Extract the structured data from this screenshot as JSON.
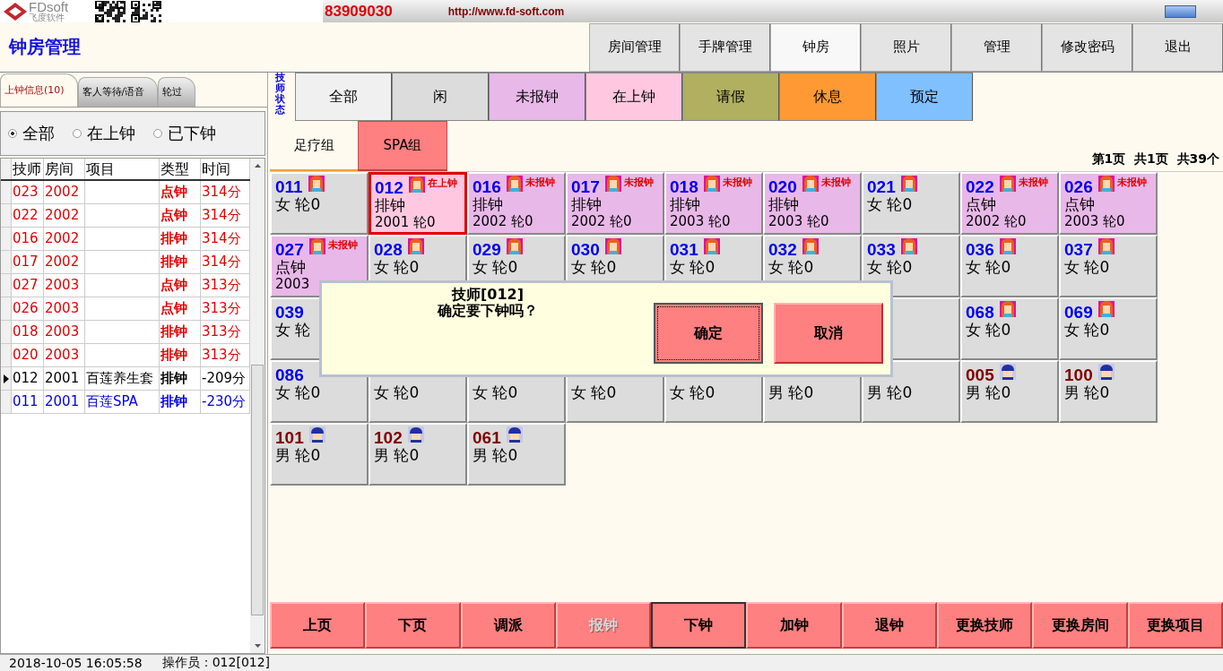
{
  "header": {
    "logo_text": "FDsoft",
    "logo_subtext": "飞度软件",
    "phone": "83909030",
    "url": "http://www.fd-soft.com"
  },
  "title": "钟房管理",
  "nav": [
    {
      "label": "房间管理",
      "selected": false
    },
    {
      "label": "手牌管理",
      "selected": false
    },
    {
      "label": "钟房",
      "selected": true
    },
    {
      "label": "照片",
      "selected": false
    },
    {
      "label": "管理",
      "selected": false
    },
    {
      "label": "修改密码",
      "selected": false
    },
    {
      "label": "退出",
      "selected": false
    }
  ],
  "left_tabs": [
    {
      "label": "上钟信息(10)",
      "selected": true
    },
    {
      "label": "客人等待/语音",
      "selected": false
    },
    {
      "label": "轮过",
      "selected": false
    }
  ],
  "radios": [
    {
      "label": "全部",
      "selected": true
    },
    {
      "label": "在上钟",
      "selected": false
    },
    {
      "label": "已下钟",
      "selected": false
    }
  ],
  "table": {
    "columns": [
      "技师",
      "房间",
      "项目",
      "类型",
      "时间"
    ],
    "rows": [
      {
        "cells": [
          "023",
          "2002",
          "",
          "点钟",
          "314分"
        ],
        "color": "#e00000",
        "selected": false
      },
      {
        "cells": [
          "022",
          "2002",
          "",
          "点钟",
          "314分"
        ],
        "color": "#e00000",
        "selected": false
      },
      {
        "cells": [
          "016",
          "2002",
          "",
          "排钟",
          "314分"
        ],
        "color": "#e00000",
        "selected": false
      },
      {
        "cells": [
          "017",
          "2002",
          "",
          "排钟",
          "314分"
        ],
        "color": "#e00000",
        "selected": false
      },
      {
        "cells": [
          "027",
          "2003",
          "",
          "点钟",
          "313分"
        ],
        "color": "#e00000",
        "selected": false
      },
      {
        "cells": [
          "026",
          "2003",
          "",
          "点钟",
          "313分"
        ],
        "color": "#e00000",
        "selected": false
      },
      {
        "cells": [
          "018",
          "2003",
          "",
          "排钟",
          "313分"
        ],
        "color": "#e00000",
        "selected": false
      },
      {
        "cells": [
          "020",
          "2003",
          "",
          "排钟",
          "313分"
        ],
        "color": "#e00000",
        "selected": false
      },
      {
        "cells": [
          "012",
          "2001",
          "百莲养生套",
          "排钟",
          "-209分"
        ],
        "color": "#000000",
        "selected": true
      },
      {
        "cells": [
          "011",
          "2001",
          "百莲SPA",
          "排钟",
          "-230分"
        ],
        "color": "#0000e0",
        "selected": false
      }
    ]
  },
  "status_label": "技师状态",
  "filters": [
    {
      "label": "全部",
      "color": "#f0f0f0"
    },
    {
      "label": "闲",
      "color": "#dcdcdc"
    },
    {
      "label": "未报钟",
      "color": "#e8b8e8"
    },
    {
      "label": "在上钟",
      "color": "#ffc8e0"
    },
    {
      "label": "请假",
      "color": "#b0b060"
    },
    {
      "label": "休息",
      "color": "#ff9933"
    },
    {
      "label": "预定",
      "color": "#80c0ff"
    }
  ],
  "groups": [
    {
      "label": "足疗组",
      "selected": true
    },
    {
      "label": "SPA组",
      "selected": false
    }
  ],
  "page_info": "第1页  共1页  共39个",
  "cards": [
    {
      "number": "011",
      "color": "#0000f0",
      "male": false,
      "kind": "idle",
      "selected": false,
      "line2": "女 轮0"
    },
    {
      "number": "012",
      "color": "#0000f0",
      "male": false,
      "kind": "onduty",
      "selected": true,
      "status": "在上钟",
      "line2": "排钟",
      "line3": "2001 轮0"
    },
    {
      "number": "016",
      "color": "#0000f0",
      "male": false,
      "kind": "unreported",
      "selected": false,
      "status": "未报钟",
      "line2": "排钟",
      "line3": "2002 轮0"
    },
    {
      "number": "017",
      "color": "#0000f0",
      "male": false,
      "kind": "unreported",
      "selected": false,
      "status": "未报钟",
      "line2": "排钟",
      "line3": "2002 轮0"
    },
    {
      "number": "018",
      "color": "#0000f0",
      "male": false,
      "kind": "unreported",
      "selected": false,
      "status": "未报钟",
      "line2": "排钟",
      "line3": "2003 轮0"
    },
    {
      "number": "020",
      "color": "#0000f0",
      "male": false,
      "kind": "unreported",
      "selected": false,
      "status": "未报钟",
      "line2": "排钟",
      "line3": "2003 轮0"
    },
    {
      "number": "021",
      "color": "#0000f0",
      "male": false,
      "kind": "idle",
      "selected": false,
      "line2": "女 轮0"
    },
    {
      "number": "022",
      "color": "#0000f0",
      "male": false,
      "kind": "unreported",
      "selected": false,
      "status": "未报钟",
      "line2": "点钟",
      "line3": "2002 轮0"
    },
    {
      "number": "026",
      "color": "#0000f0",
      "male": false,
      "kind": "unreported",
      "selected": false,
      "status": "未报钟",
      "line2": "点钟",
      "line3": "2003 轮0"
    },
    {
      "number": "027",
      "color": "#0000f0",
      "male": false,
      "kind": "unreported",
      "selected": false,
      "status": "未报钟",
      "line2": "点钟",
      "line3": "2003"
    },
    {
      "number": "028",
      "color": "#0000f0",
      "male": false,
      "kind": "idle",
      "selected": false,
      "line2": "女 轮0"
    },
    {
      "number": "029",
      "color": "#0000f0",
      "male": false,
      "kind": "idle",
      "selected": false,
      "line2": "女 轮0"
    },
    {
      "number": "030",
      "color": "#0000f0",
      "male": false,
      "kind": "idle",
      "selected": false,
      "line2": "女 轮0"
    },
    {
      "number": "031",
      "color": "#0000f0",
      "male": false,
      "kind": "idle",
      "selected": false,
      "line2": "女 轮0"
    },
    {
      "number": "032",
      "color": "#0000f0",
      "male": false,
      "kind": "idle",
      "selected": false,
      "line2": "女 轮0"
    },
    {
      "number": "033",
      "color": "#0000f0",
      "male": false,
      "kind": "idle",
      "selected": false,
      "line2": "女 轮0"
    },
    {
      "number": "036",
      "color": "#0000f0",
      "male": false,
      "kind": "idle",
      "selected": false,
      "line2": "女 轮0"
    },
    {
      "number": "037",
      "color": "#0000f0",
      "male": false,
      "kind": "idle",
      "selected": false,
      "line2": "女 轮0"
    },
    {
      "number": "039",
      "color": "#0000f0",
      "kind": "idle",
      "selected": false,
      "line2": "女 轮"
    },
    {
      "kind": "idle"
    },
    {
      "number": "068",
      "color": "#0000f0",
      "male": false,
      "kind": "idle",
      "selected": false,
      "line2": "女 轮0"
    },
    {
      "number": "069",
      "color": "#0000f0",
      "male": false,
      "kind": "idle",
      "selected": false,
      "line2": "女 轮0"
    },
    {
      "number": "086",
      "color": "#0000f0",
      "kind": "idle",
      "selected": false,
      "line2": "女 轮0"
    },
    {
      "kind": "idle",
      "line2": "女 轮0"
    },
    {
      "kind": "idle",
      "line2": "女 轮0"
    },
    {
      "kind": "idle",
      "line2": "女 轮0"
    },
    {
      "kind": "idle",
      "line2": "女 轮0"
    },
    {
      "kind": "idle",
      "line2": "男 轮0"
    },
    {
      "kind": "idle",
      "line2": "男 轮0"
    },
    {
      "number": "005",
      "color": "#800000",
      "male": true,
      "kind": "idle",
      "selected": false,
      "line2": "男 轮0"
    },
    {
      "number": "100",
      "color": "#800000",
      "male": true,
      "kind": "idle",
      "selected": false,
      "line2": "男 轮0"
    },
    {
      "number": "101",
      "color": "#800000",
      "male": true,
      "kind": "idle",
      "selected": false,
      "line2": "男 轮0"
    },
    {
      "number": "102",
      "color": "#800000",
      "male": true,
      "kind": "idle",
      "selected": false,
      "line2": "男 轮0"
    },
    {
      "number": "061",
      "color": "#800000",
      "male": true,
      "kind": "idle",
      "selected": false,
      "line2": "男 轮0"
    }
  ],
  "dialog": {
    "lines": [
      "技师[012]",
      "确定要下钟吗？"
    ],
    "buttons": [
      {
        "label": "确定",
        "focused": true
      },
      {
        "label": "取消",
        "focused": false
      }
    ]
  },
  "actions": [
    {
      "label": "上页",
      "disabled": false,
      "focused": false
    },
    {
      "label": "下页",
      "disabled": false,
      "focused": false
    },
    {
      "label": "调派",
      "disabled": false,
      "focused": false
    },
    {
      "label": "报钟",
      "disabled": true,
      "focused": false
    },
    {
      "label": "下钟",
      "disabled": false,
      "focused": true
    },
    {
      "label": "加钟",
      "disabled": false,
      "focused": false
    },
    {
      "label": "退钟",
      "disabled": false,
      "focused": false
    },
    {
      "label": "更换技师",
      "disabled": false,
      "focused": false
    },
    {
      "label": "更换房间",
      "disabled": false,
      "focused": false
    },
    {
      "label": "更换项目",
      "disabled": false,
      "focused": false
    }
  ],
  "status_bar": {
    "datetime": "2018-10-05 16:05:58",
    "operator": "操作员：012[012]"
  }
}
